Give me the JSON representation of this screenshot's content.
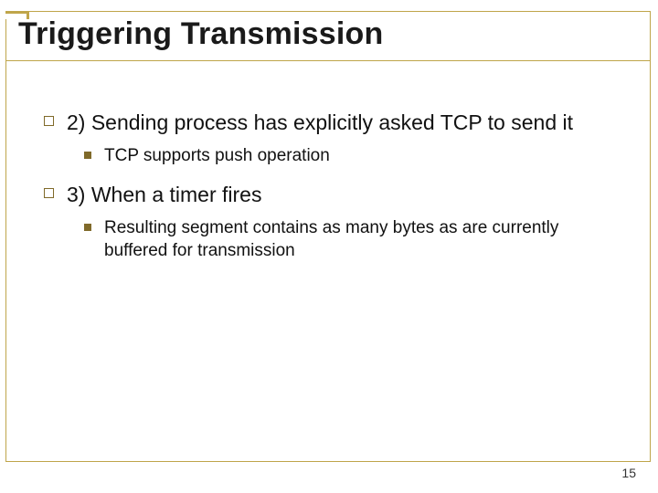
{
  "title": "Triggering Transmission",
  "items": [
    {
      "text": "2) Sending process has explicitly asked TCP to send it",
      "sub": [
        {
          "text": "TCP supports push operation"
        }
      ]
    },
    {
      "text": "3) When a timer fires",
      "sub": [
        {
          "text": "Resulting segment contains as many bytes as are currently buffered for transmission"
        }
      ]
    }
  ],
  "page_number": "15"
}
